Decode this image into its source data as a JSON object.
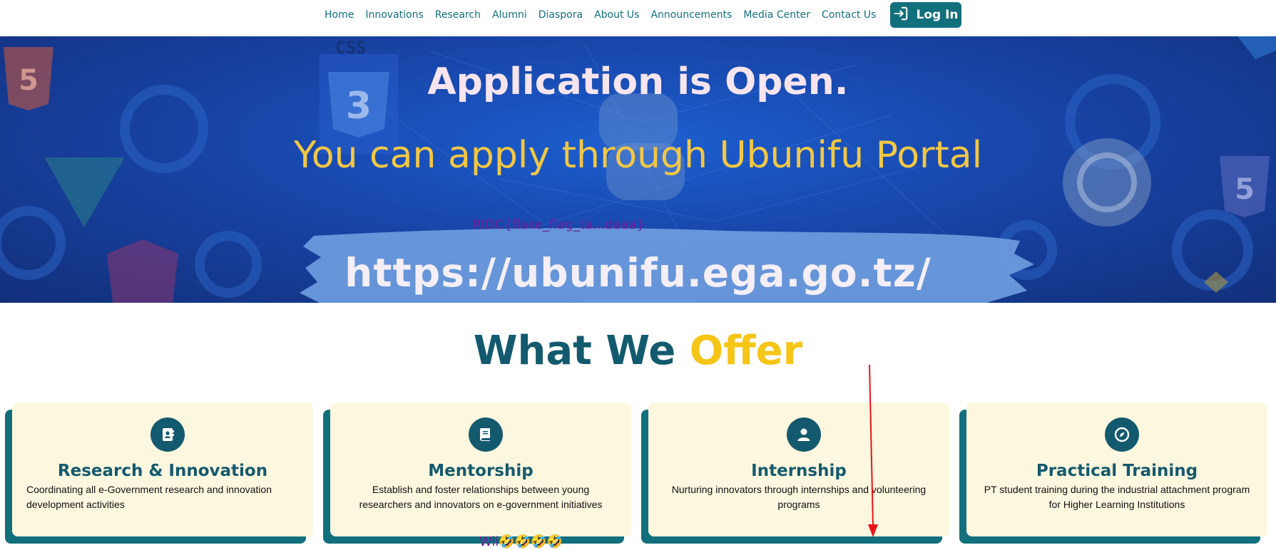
{
  "nav": {
    "links": [
      "Home",
      "Innovations",
      "Research",
      "Alumni",
      "Diaspora",
      "About Us",
      "Announcements",
      "Media Center",
      "Contact Us"
    ],
    "login_label": "Log In",
    "login_icon": "login-icon",
    "color": "#12707d"
  },
  "hero": {
    "title": "Application is Open.",
    "subtitle": "You can apply through Ubunifu Portal",
    "overlay_text": "RIDC{flake_flag_ta...daaa}",
    "url": "https://ubunifu.ega.go.tz/",
    "bg_icons": [
      "html5-icon",
      "css3-icon",
      "python-icon",
      "vue-icon",
      "angular-icon",
      "pangolin-icon"
    ]
  },
  "offer": {
    "title_part1": "What We",
    "title_part2": "Offer",
    "cards": [
      {
        "icon": "contact-book-icon",
        "title": "Research & Innovation",
        "desc": "Coordinating all e-Government research and innovation development activities"
      },
      {
        "icon": "book-icon",
        "title": "Mentorship",
        "desc": "Establish and foster relationships between young researchers and innovators on e-government initiatives"
      },
      {
        "icon": "user-icon",
        "title": "Internship",
        "desc": "Nurturing innovators through internships and volunteering programs"
      },
      {
        "icon": "compass-icon",
        "title": "Practical Training",
        "desc": "PT student training during the industrial attachment program for Higher Learning Institutions"
      }
    ]
  },
  "overlay_bottom_text": "Wii🤣🤣🤣🤣",
  "colors": {
    "teal": "#12707d",
    "dark_teal": "#145a6e",
    "gold": "#f5c518",
    "card_bg": "#fcf7df",
    "annotation_red": "#e8141b",
    "overlay_purple": "#6f1f9a"
  }
}
